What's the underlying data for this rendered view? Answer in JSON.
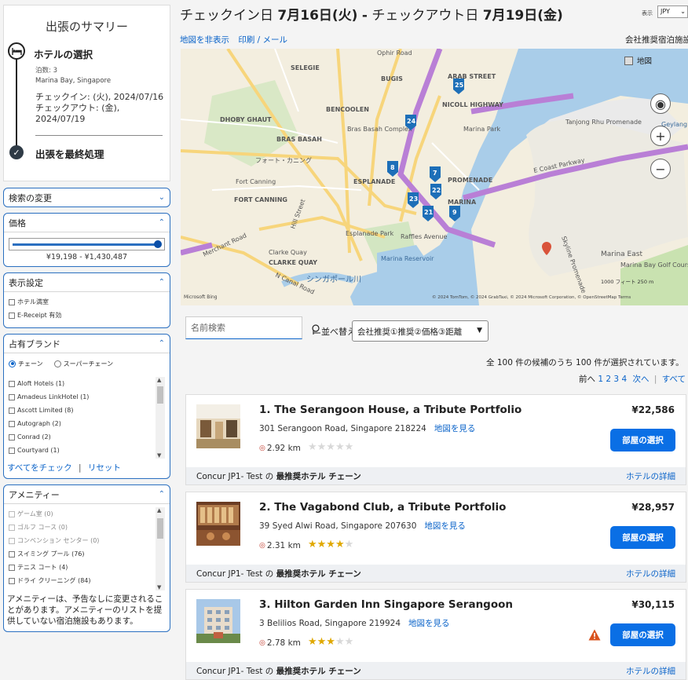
{
  "summary": {
    "title": "出張のサマリー",
    "hotel_step": "ホテルの選択",
    "nights": "泊数: 3",
    "location": "Marina Bay, Singapore",
    "checkin": "チェックイン: (火), 2024/07/16",
    "checkout_label": "チェックアウト: (金),",
    "checkout_date": "2024/07/19",
    "final_step": "出張を最終処理"
  },
  "panels": {
    "search_change": "検索の変更",
    "price": "価格",
    "price_range": "¥19,198 - ¥1,430,487",
    "display": "表示設定",
    "display_options": [
      "ホテル満室",
      "E-Receipt 有効"
    ],
    "brand": "占有ブランド",
    "brand_radio": [
      "チェーン",
      "スーパーチェーン"
    ],
    "brands": [
      "Aloft Hotels (1)",
      "Amadeus LinkHotel (1)",
      "Ascott Limited (8)",
      "Autograph (2)",
      "Conrad (2)",
      "Courtyard (1)"
    ],
    "check_all": "すべてをチェック",
    "reset": "リセット",
    "amenity": "アメニティー",
    "amenities": [
      "ゲーム室 (0)",
      "ゴルフ コース (0)",
      "コンベンション センター (0)",
      "スイミング プール (76)",
      "テニス コート (4)",
      "ドライ クリーニング (84)"
    ],
    "amenity_note": "アメニティーは、予告なしに変更されることがあります。アメニティーのリストを提供していない宿泊施設もあります。"
  },
  "header": {
    "title_prefix": "チェックイン日",
    "checkin_date": "7月16日",
    "checkin_dow": "(火)",
    "sep": "-",
    "title_mid": "チェックアウト日",
    "checkout_date": "7月19日",
    "checkout_dow": "(金)",
    "display_label": "表示",
    "currency": "JPY"
  },
  "maplinks": {
    "hide_map": "地図を非表示",
    "print_mail": "印刷 / メール",
    "company_hotels": "会社推奨宿泊施設"
  },
  "map": {
    "type_label": "地図",
    "labels": [
      "Ophir Road",
      "SELEGIE",
      "BUGIS",
      "ARAB STREET",
      "NICOLL HIGHWAY",
      "DHOBY GHAUT",
      "BENCOOLEN",
      "Bras Basah Complex",
      "Marina Park",
      "BRAS BASAH",
      "フォート・カニング",
      "ESPLANADE",
      "PROMENADE",
      "Fort Canning",
      "FORT CANNING",
      "Esplanade Park",
      "Raffles Avenue",
      "MARINA",
      "Clarke Quay",
      "CLARKE QUAY",
      "Marina Reservoir",
      "シンガポール川",
      "Marina East",
      "Marina Bay Golf Course",
      "E Coast Parkway",
      "Tanjong Rhu Promenade",
      "Geylang River",
      "Merchant Road",
      "N Canal Road",
      "Hill Street",
      "Skyline Promenade"
    ],
    "markers": [
      "25",
      "24",
      "8",
      "7",
      "22",
      "23",
      "21",
      "9"
    ],
    "scale": "1000 フィート    250 m",
    "copyright": "© 2024 TomTom, © 2024 GrabTaxi, © 2024 Microsoft Corporation, © OpenStreetMap  Terms",
    "bing": "Microsoft Bing"
  },
  "search": {
    "placeholder": "名前検索",
    "sort_label": "並べ替え:",
    "sort_value": "会社推奨①推奨②価格③距離"
  },
  "results": {
    "count_text": "全 100 件の候補のうち 100 件が選択されています。",
    "prev": "前へ",
    "pages": [
      "1",
      "2",
      "3",
      "4"
    ],
    "next": "次へ",
    "all": "すべて"
  },
  "hotels": [
    {
      "name": "1. The Serangoon House, a Tribute Portfolio",
      "address": "301 Serangoon Road, Singapore 218224",
      "map_link": "地図を見る",
      "distance": "2.92 km",
      "stars": 0,
      "price": "¥22,586",
      "button": "部屋の選択",
      "foot_prefix": "Concur JP1- Test の",
      "foot_bold": "最推奨ホテル チェーン",
      "details": "ホテルの詳細",
      "warning": false
    },
    {
      "name": "2. The Vagabond Club, a Tribute Portfolio",
      "address": "39 Syed Alwi Road, Singapore 207630",
      "map_link": "地図を見る",
      "distance": "2.31 km",
      "stars": 4,
      "price": "¥28,957",
      "button": "部屋の選択",
      "foot_prefix": "Concur JP1- Test の",
      "foot_bold": "最推奨ホテル チェーン",
      "details": "ホテルの詳細",
      "warning": false
    },
    {
      "name": "3. Hilton Garden Inn Singapore Serangoon",
      "address": "3 Belilios Road, Singapore 219924",
      "map_link": "地図を見る",
      "distance": "2.78 km",
      "stars": 3,
      "price": "¥30,115",
      "button": "部屋の選択",
      "foot_prefix": "Concur JP1- Test の",
      "foot_bold": "最推奨ホテル チェーン",
      "details": "ホテルの詳細",
      "warning": true
    }
  ],
  "colors": {
    "accent": "#0a6fe5",
    "link": "#0a63c9",
    "panel_border": "#2a6fc0",
    "star": "#e0a800"
  }
}
